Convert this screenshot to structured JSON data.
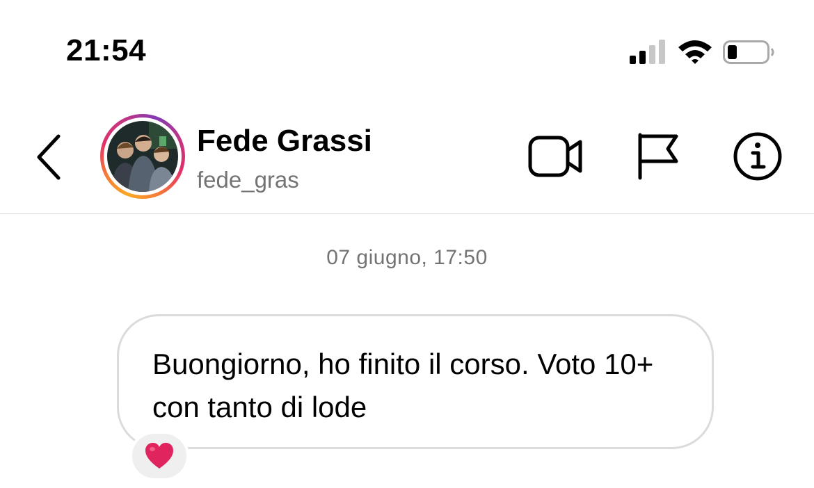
{
  "status_bar": {
    "time": "21:54",
    "icons": [
      "cellular-signal-icon",
      "wifi-icon",
      "battery-icon"
    ]
  },
  "header": {
    "back_icon": "chevron-left-icon",
    "contact": {
      "name": "Fede Grassi",
      "username": "fede_gras",
      "has_story_ring": true
    },
    "actions": [
      {
        "icon": "video-call-icon"
      },
      {
        "icon": "flag-icon"
      },
      {
        "icon": "info-icon"
      }
    ]
  },
  "conversation": {
    "timestamp": "07 giugno, 17:50",
    "messages": [
      {
        "text": "Buongiorno, ho finito il corso. Voto 10+ con tanto di lode",
        "reaction": "heart-emoji"
      }
    ]
  },
  "colors": {
    "secondary_text": "#737373",
    "bubble_border": "#dbdbdb",
    "reaction_bg": "#efefef",
    "heart": "#e0245e"
  }
}
